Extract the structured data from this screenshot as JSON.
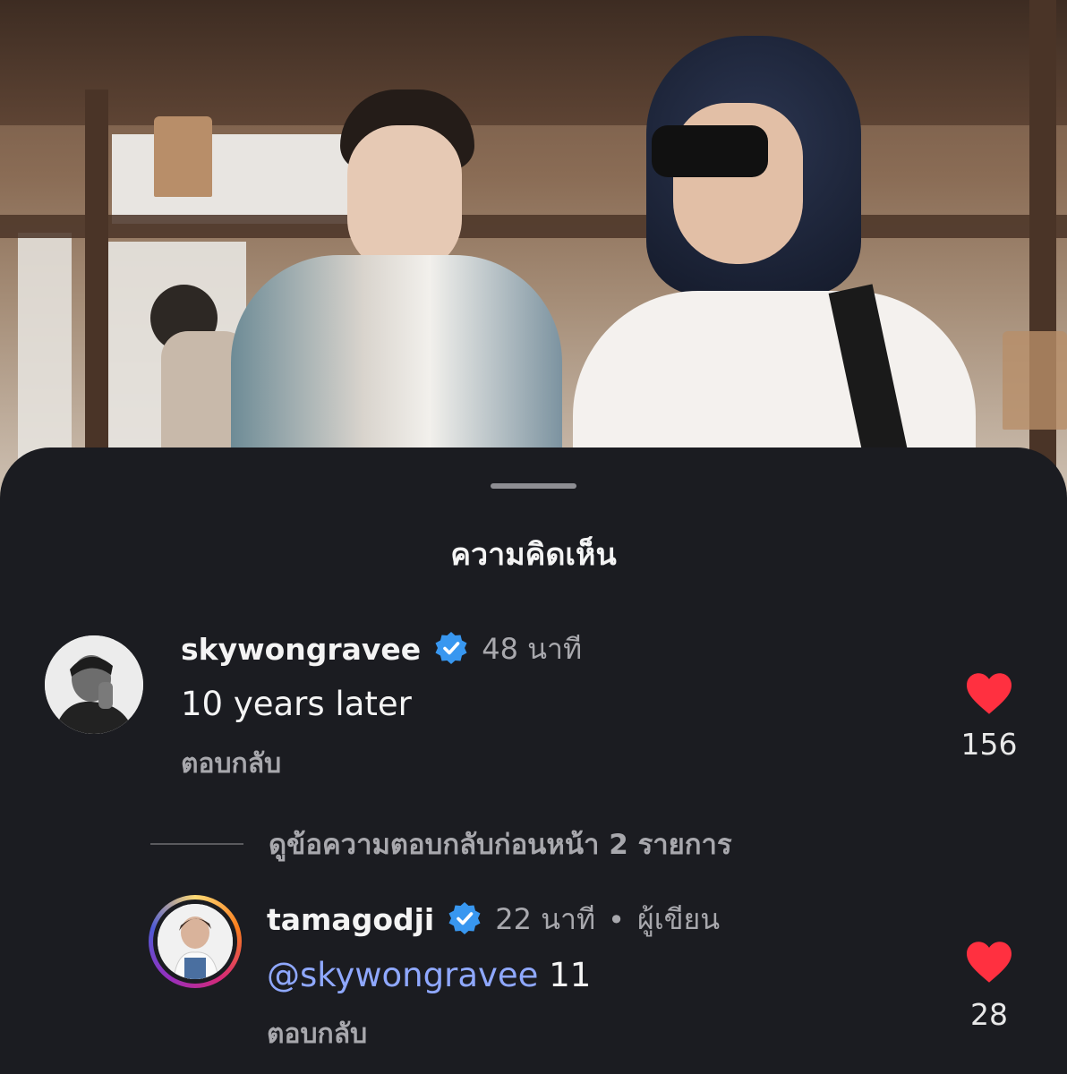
{
  "sheet": {
    "title": "ความคิดเห็น"
  },
  "comments": [
    {
      "username": "skywongravee",
      "verified": true,
      "time": "48 นาที",
      "text": "10 years later",
      "reply_label": "ตอบกลับ",
      "likes": "156"
    }
  ],
  "view_replies": {
    "label": "ดูข้อความตอบกลับก่อนหน้า 2 รายการ"
  },
  "replies": [
    {
      "username": "tamagodji",
      "verified": true,
      "time": "22 นาที",
      "separator": "•",
      "author_tag": "ผู้เขียน",
      "mention": "@skywongravee",
      "text": "11",
      "reply_label": "ตอบกลับ",
      "likes": "28"
    }
  ],
  "colors": {
    "background": "#1b1c21",
    "heart": "#ff3040",
    "verified": "#3897f0",
    "mention": "#8fa8ff",
    "muted": "#a8a8ad"
  }
}
